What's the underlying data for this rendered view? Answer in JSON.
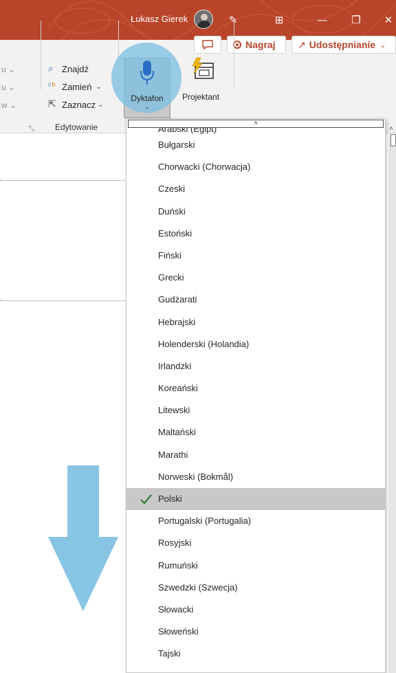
{
  "titlebar": {
    "user_name": "Łukasz Gierek",
    "icons": [
      "pen-icon",
      "display-options-icon",
      "minimize-icon",
      "restore-icon",
      "close-icon"
    ],
    "colors": {
      "background": "#b8442a",
      "text": "#ffffff"
    }
  },
  "ribbon": {
    "comments_icon": "comment-icon",
    "record_label": "Nagraj",
    "share_label": "Udostępnianie",
    "partial_items": [
      "u",
      "u",
      "w"
    ],
    "editing": {
      "find_label": "Znajdź",
      "replace_label": "Zamień",
      "select_label": "Zaznacz",
      "group_label": "Edytowanie"
    },
    "dictate_label": "Dyktafon",
    "designer_label": "Projektant",
    "accent_color": "#b8442a",
    "highlight_color": "#7ec0e2"
  },
  "language_menu": {
    "scroll_up_glyph": "˄",
    "items": [
      "Arabski (Egipt)",
      "Bułgarski",
      "Chorwacki (Chorwacja)",
      "Czeski",
      "Duński",
      "Estoński",
      "Fiński",
      "Grecki",
      "Gudżarati",
      "Hebrajski",
      "Holenderski (Holandia)",
      "Irlandzki",
      "Koreański",
      "Litewski",
      "Maltański",
      "Marathi",
      "Norweski (Bokmål)",
      "Polski",
      "Portugalski (Portugalia)",
      "Rosyjski",
      "Rumuński",
      "Szwedzki (Szwecja)",
      "Słowacki",
      "Słoweński",
      "Tajski"
    ],
    "selected": "Polski",
    "check_color": "#2e7d32"
  }
}
